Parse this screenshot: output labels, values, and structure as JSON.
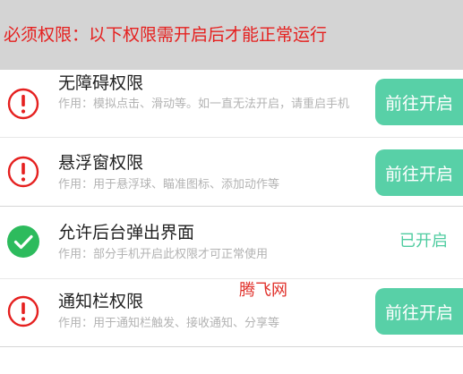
{
  "banner": {
    "text": "必须权限：以下权限需开启后才能正常运行"
  },
  "permissions": [
    {
      "title": "无障碍权限",
      "description": "作用：模拟点击、滑动等。如一直无法开启，请重启手机",
      "icon": "alert-circle-icon",
      "action": "前往开启",
      "granted": false
    },
    {
      "title": "悬浮窗权限",
      "description": "作用：用于悬浮球、瞄准图标、添加动作等",
      "icon": "alert-circle-icon",
      "action": "前往开启",
      "granted": false
    },
    {
      "title": "允许后台弹出界面",
      "description": "作用：部分手机开启此权限才可正常使用",
      "icon": "check-circle-icon",
      "status": "已开启",
      "granted": true
    },
    {
      "title": "通知栏权限",
      "description": "作用：用于通知栏触发、接收通知、分享等",
      "icon": "alert-circle-icon",
      "action": "前往开启",
      "granted": false
    }
  ],
  "watermark": "腾飞网",
  "colors": {
    "alert": "#e5201f",
    "accent": "#58d0a7",
    "granted": "#2dbb5d",
    "banner_bg": "#d4d4d4"
  }
}
